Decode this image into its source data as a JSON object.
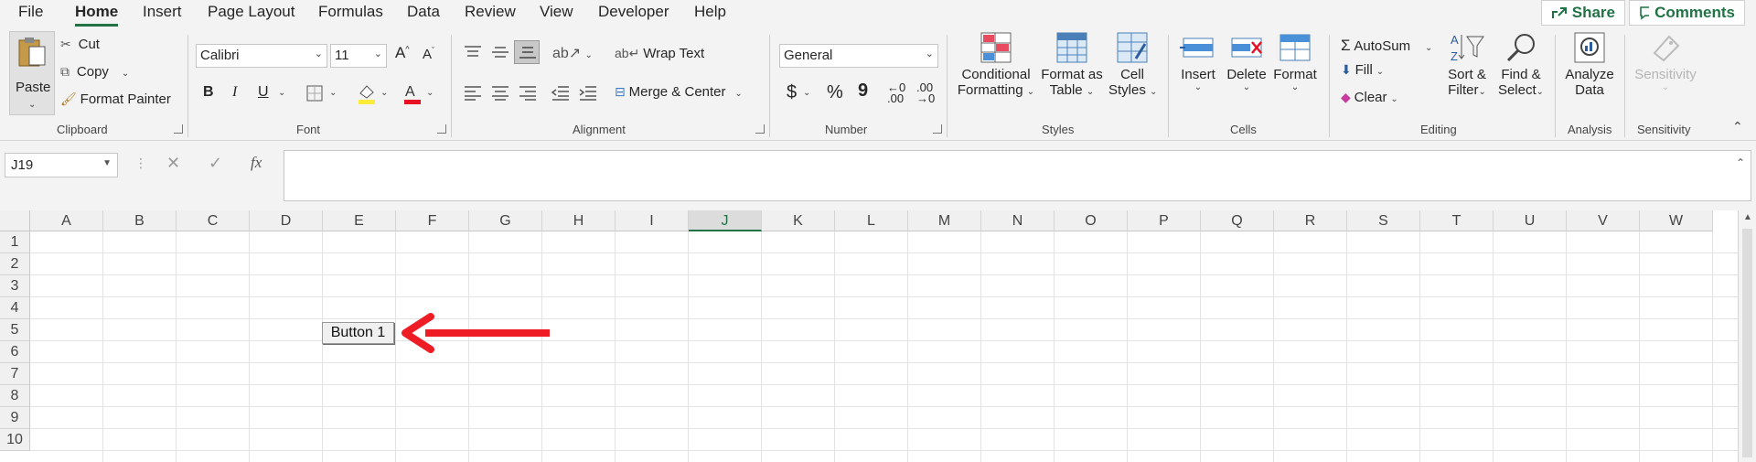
{
  "menu": {
    "tabs": [
      "File",
      "Home",
      "Insert",
      "Page Layout",
      "Formulas",
      "Data",
      "Review",
      "View",
      "Developer",
      "Help"
    ],
    "active": "Home",
    "share_label": "Share",
    "comments_label": "Comments"
  },
  "ribbon": {
    "clipboard": {
      "paste": "Paste",
      "cut": "Cut",
      "copy": "Copy",
      "format_painter": "Format Painter",
      "group": "Clipboard"
    },
    "font": {
      "family": "Calibri",
      "size": "11",
      "bold": "B",
      "italic": "I",
      "underline": "U",
      "group": "Font"
    },
    "alignment": {
      "wrap_text": "Wrap Text",
      "merge_center": "Merge & Center",
      "group": "Alignment"
    },
    "number": {
      "format": "General",
      "currency": "$",
      "percent": "%",
      "comma": "9",
      "inc_decimal": ".00",
      "dec_decimal": ".00",
      "group": "Number"
    },
    "styles": {
      "conditional_1": "Conditional",
      "conditional_2": "Formatting",
      "format_table_1": "Format as",
      "format_table_2": "Table",
      "cell_styles_1": "Cell",
      "cell_styles_2": "Styles",
      "group": "Styles"
    },
    "cells": {
      "insert": "Insert",
      "delete": "Delete",
      "format": "Format",
      "group": "Cells"
    },
    "editing": {
      "autosum": "AutoSum",
      "fill": "Fill",
      "clear": "Clear",
      "sort_1": "Sort &",
      "sort_2": "Filter",
      "find_1": "Find &",
      "find_2": "Select",
      "group": "Editing"
    },
    "analysis": {
      "analyze_1": "Analyze",
      "analyze_2": "Data",
      "group": "Analysis"
    },
    "sensitivity": {
      "label": "Sensitivity",
      "group": "Sensitivity"
    }
  },
  "formula_bar": {
    "name_box": "J19",
    "cancel": "✕",
    "enter": "✓",
    "fx": "fx",
    "content": ""
  },
  "sheet": {
    "columns": [
      "A",
      "B",
      "C",
      "D",
      "E",
      "F",
      "G",
      "H",
      "I",
      "J",
      "K",
      "L",
      "M",
      "N",
      "O",
      "P",
      "Q",
      "R",
      "S",
      "T",
      "U",
      "V",
      "W"
    ],
    "rows": [
      "1",
      "2",
      "3",
      "4",
      "5",
      "6",
      "7",
      "8",
      "9",
      "10"
    ],
    "selected_column": "J",
    "button_label": "Button 1"
  },
  "colors": {
    "accent": "#217346",
    "arrow": "#ee1c25",
    "font_color": "#e81123",
    "highlight": "#ffeb3b"
  }
}
